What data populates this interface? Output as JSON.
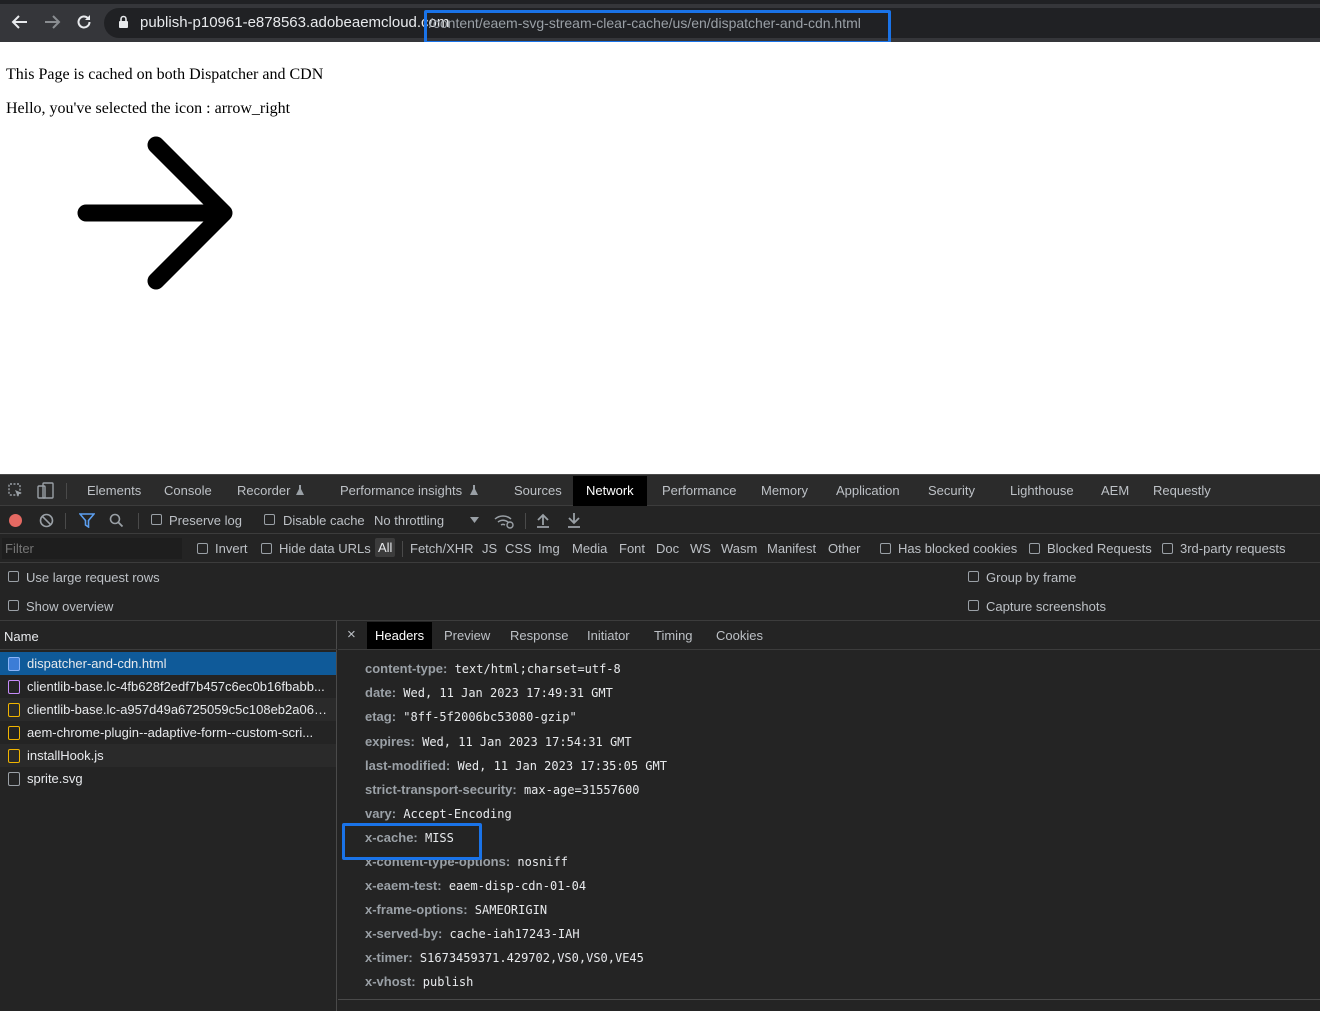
{
  "browser": {
    "url_host": "publish-p10961-e878563.adobeaemcloud.com",
    "url_path": "/content/eaem-svg-stream-clear-cache/us/en/dispatcher-and-cdn.html"
  },
  "page": {
    "line1": "This Page is cached on both Dispatcher and CDN",
    "line2": "Hello, you've selected the icon : arrow_right",
    "icon": "arrow-right-icon"
  },
  "devtools": {
    "tabs": [
      "Elements",
      "Console",
      "Recorder",
      "Performance insights",
      "Sources",
      "Network",
      "Performance",
      "Memory",
      "Application",
      "Security",
      "Lighthouse",
      "AEM",
      "Requestly"
    ],
    "active_tab": "Network",
    "toolbar": {
      "preserve_log": "Preserve log",
      "disable_cache": "Disable cache",
      "throttling": "No throttling"
    },
    "filter": {
      "placeholder": "Filter",
      "invert": "Invert",
      "hide_data_urls": "Hide data URLs",
      "types": [
        "All",
        "Fetch/XHR",
        "JS",
        "CSS",
        "Img",
        "Media",
        "Font",
        "Doc",
        "WS",
        "Wasm",
        "Manifest",
        "Other"
      ],
      "has_blocked_cookies": "Has blocked cookies",
      "blocked_requests": "Blocked Requests",
      "third_party": "3rd-party requests"
    },
    "options": {
      "large_rows": "Use large request rows",
      "group_by_frame": "Group by frame",
      "show_overview": "Show overview",
      "capture_screenshots": "Capture screenshots"
    },
    "requests": {
      "column_name": "Name",
      "items": [
        "dispatcher-and-cdn.html",
        "clientlib-base.lc-4fb628f2edf7b457c6ec0b16fbabb...",
        "clientlib-base.lc-a957d49a6725059c5c108eb2a06d...",
        "aem-chrome-plugin--adaptive-form--custom-scri...",
        "installHook.js",
        "sprite.svg"
      ]
    },
    "detail": {
      "close": "×",
      "tabs": [
        "Headers",
        "Preview",
        "Response",
        "Initiator",
        "Timing",
        "Cookies"
      ],
      "active_tab": "Headers",
      "headers": [
        {
          "key": "content-type:",
          "value": "text/html;charset=utf-8"
        },
        {
          "key": "date:",
          "value": "Wed, 11 Jan 2023 17:49:31 GMT"
        },
        {
          "key": "etag:",
          "value": "\"8ff-5f2006bc53080-gzip\""
        },
        {
          "key": "expires:",
          "value": "Wed, 11 Jan 2023 17:54:31 GMT"
        },
        {
          "key": "last-modified:",
          "value": "Wed, 11 Jan 2023 17:35:05 GMT"
        },
        {
          "key": "strict-transport-security:",
          "value": "max-age=31557600"
        },
        {
          "key": "vary:",
          "value": "Accept-Encoding"
        },
        {
          "key": "x-cache:",
          "value": "MISS"
        },
        {
          "key": "x-content-type-options:",
          "value": "nosniff"
        },
        {
          "key": "x-eaem-test:",
          "value": "eaem-disp-cdn-01-04"
        },
        {
          "key": "x-frame-options:",
          "value": "SAMEORIGIN"
        },
        {
          "key": "x-served-by:",
          "value": "cache-iah17243-IAH"
        },
        {
          "key": "x-timer:",
          "value": "S1673459371.429702,VS0,VS0,VE45"
        },
        {
          "key": "x-vhost:",
          "value": "publish"
        }
      ]
    }
  },
  "colors": {
    "highlight": "#1a73e8",
    "selected_row": "#0f5a99"
  }
}
